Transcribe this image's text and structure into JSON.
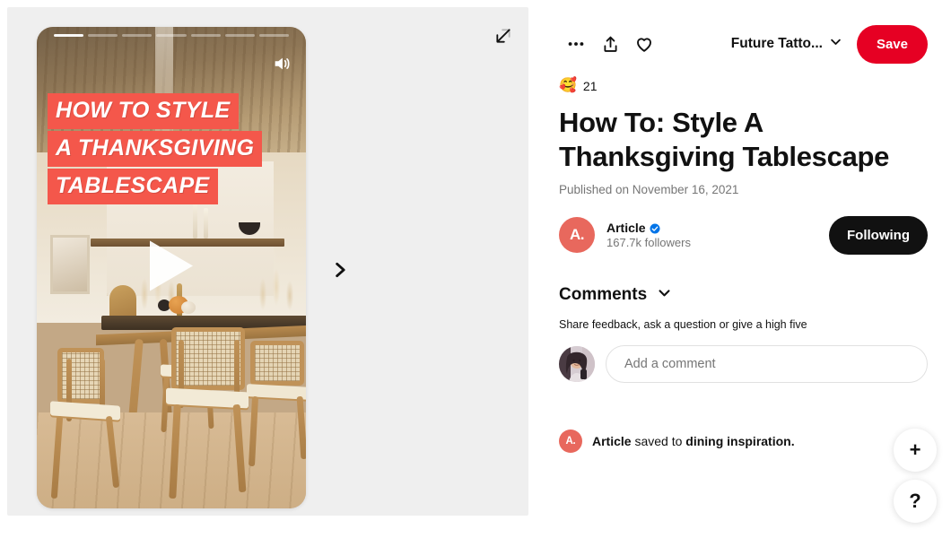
{
  "media": {
    "story_segments": 7,
    "active_segment_index": 0,
    "sound_icon": "speaker-on-icon",
    "play_icon": "play-triangle-icon",
    "next_icon": "chevron-right-icon",
    "expand_icon": "expand-diagonal-icon",
    "overlay_lines": [
      "HOW TO STYLE",
      "A THANKSGIVING",
      "TABLESCAPE"
    ],
    "overlay_bg_color": "#f4574b",
    "overlay_text_color": "#ffffff",
    "panel_bg_color": "#efefef",
    "alt": "Dining room with wooden table, cane chairs and autumn pumpkins"
  },
  "toolbar": {
    "more_icon": "ellipsis-icon",
    "share_icon": "share-upload-icon",
    "favorite_icon": "heart-outline-icon",
    "board_name": "Future Tatto...",
    "board_chevron_icon": "chevron-down-icon",
    "save_label": "Save",
    "save_color": "#e60023"
  },
  "reaction": {
    "emoji": "🥰",
    "emoji_name": "smiling-face-with-hearts",
    "count": "21"
  },
  "pin": {
    "title": "How To: Style A Thanksgiving Tablescape",
    "published": "Published on November 16, 2021"
  },
  "creator": {
    "avatar_initials": "A.",
    "avatar_color": "#e8685d",
    "name": "Article",
    "verified_icon": "verified-badge-icon",
    "verified_color": "#0074e8",
    "followers": "167.7k followers",
    "follow_label": "Following",
    "follow_bg_color": "#111111"
  },
  "comments": {
    "title": "Comments",
    "chevron_icon": "chevron-down-icon",
    "hint": "Share feedback, ask a question or give a high five",
    "input_placeholder": "Add a comment",
    "user_avatar_name": "user-profile-photo"
  },
  "toast": {
    "avatar_initials": "A.",
    "prefix": "Article",
    "middle": " saved to ",
    "board": "dining inspiration."
  },
  "fabs": {
    "create_label": "+",
    "create_name": "create-button",
    "help_label": "?",
    "help_name": "help-button"
  }
}
